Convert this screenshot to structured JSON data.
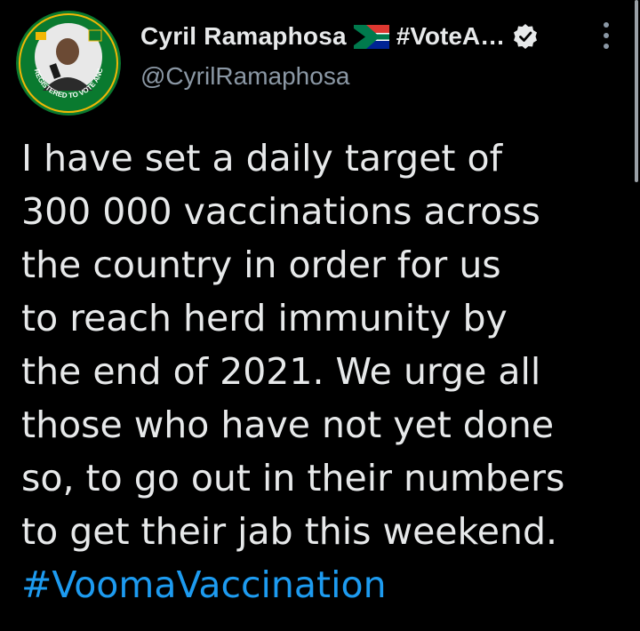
{
  "author": {
    "display_name": "Cyril Ramaphosa",
    "name_suffix": "#VoteA…",
    "handle": "@CyrilRamaphosa",
    "flag_icon": "south-africa-flag-icon",
    "verified_icon": "verified-badge-icon",
    "avatar_ring_text": "REGISTERED TO VOTE ANC"
  },
  "tweet": {
    "lines": [
      "I have set a daily target of",
      "300 000 vaccinations across",
      "the country in order for us",
      "to reach herd immunity by",
      "the end of 2021. We urge all",
      "those who have not yet done",
      "so, to go out in their numbers",
      "to get their jab this weekend."
    ],
    "hashtag": "#VoomaVaccination"
  },
  "colors": {
    "background": "#000000",
    "text": "#e7e9ea",
    "secondary": "#8b98a5",
    "link": "#1d9bf0",
    "anc_green": "#0a7a2f",
    "anc_gold": "#f2b705"
  }
}
